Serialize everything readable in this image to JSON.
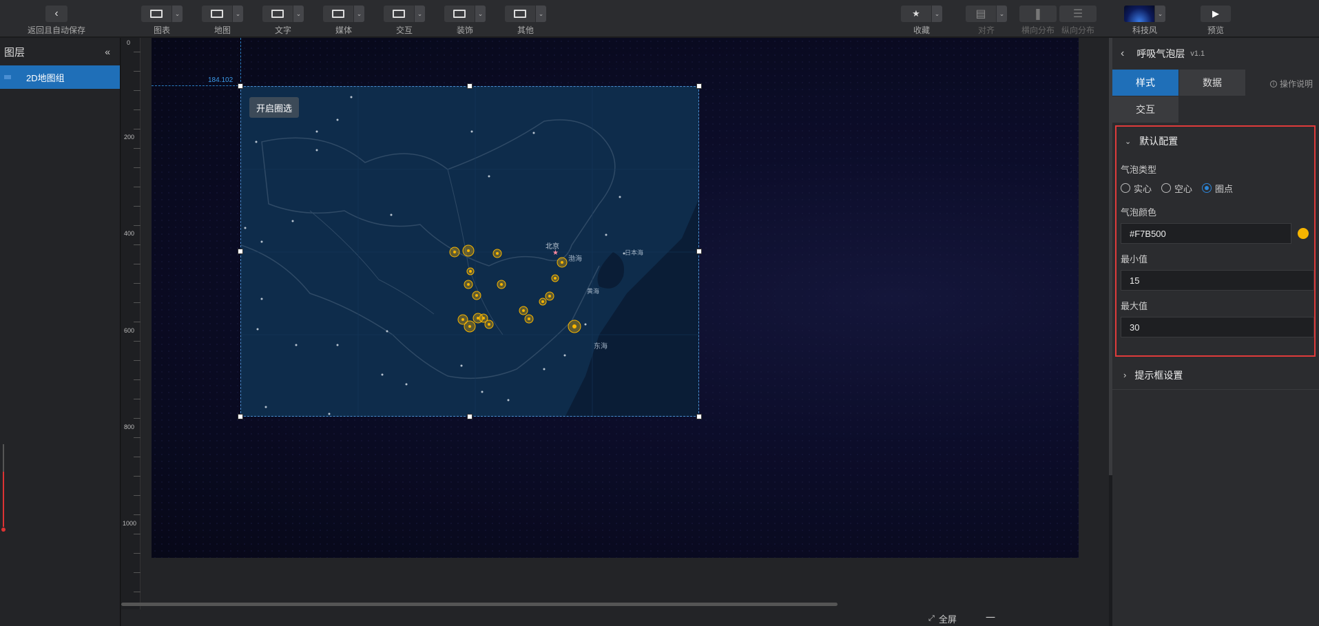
{
  "toolbar": {
    "back_label": "返回且自动保存",
    "groups": [
      {
        "label": "图表",
        "icon": "chart-icon"
      },
      {
        "label": "地图",
        "icon": "map-icon"
      },
      {
        "label": "文字",
        "icon": "text-icon"
      },
      {
        "label": "媒体",
        "icon": "media-icon"
      },
      {
        "label": "交互",
        "icon": "interaction-icon"
      },
      {
        "label": "装饰",
        "icon": "decoration-icon"
      },
      {
        "label": "其他",
        "icon": "other-icon"
      }
    ],
    "favorite_label": "收藏",
    "align_label": "对齐",
    "h_distribute_label": "横向分布",
    "v_distribute_label": "纵向分布",
    "theme_label": "科技风",
    "preview_label": "预览"
  },
  "layers": {
    "title": "图层",
    "items": [
      {
        "label": "2D地图组"
      }
    ]
  },
  "canvas": {
    "ruler_ticks": [
      "0",
      "200",
      "400",
      "600",
      "800",
      "1000"
    ],
    "guide_coord": "184.102",
    "map_button": "开启圈选"
  },
  "bottom": {
    "fullscreen_label": "全屏",
    "zoom_minus": "一"
  },
  "panel": {
    "title": "呼吸气泡层",
    "version": "v1.1",
    "tabs": [
      "样式",
      "数据",
      "交互"
    ],
    "active_tab": "样式",
    "help_label": "操作说明",
    "default_section": "默认配置",
    "bubble_type_label": "气泡类型",
    "bubble_types": [
      "实心",
      "空心",
      "圈点"
    ],
    "bubble_type_selected": "圈点",
    "bubble_color_label": "气泡颜色",
    "bubble_color_value": "#F7B500",
    "bubble_color": "#F7B500",
    "min_label": "最小值",
    "min_value": "15",
    "max_label": "最大值",
    "max_value": "30",
    "tooltip_section": "提示框设置"
  },
  "colors": {
    "accent": "#1f6fb8",
    "highlight_border": "#e03b3b"
  }
}
